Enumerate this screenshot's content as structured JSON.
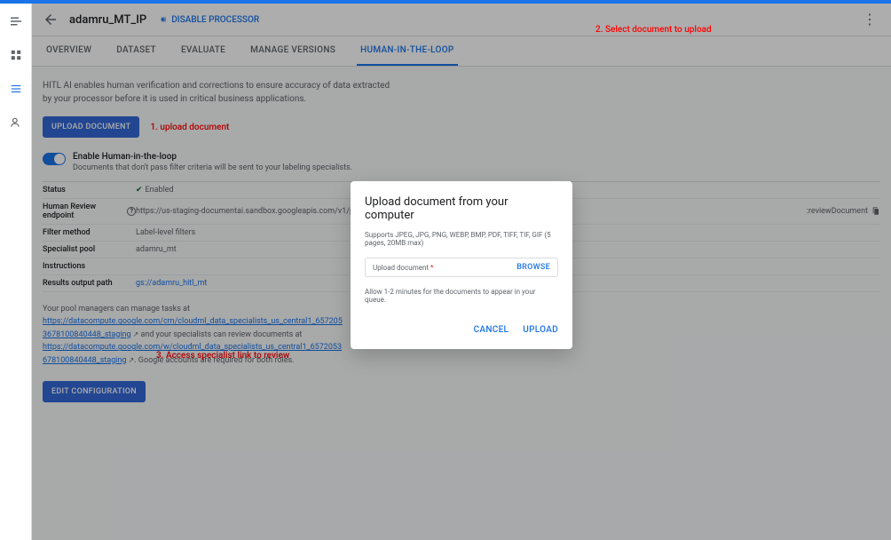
{
  "header": {
    "processor_name": "adamru_MT_IP",
    "disable_label": "DISABLE PROCESSOR"
  },
  "tabs": [
    {
      "label": "OVERVIEW"
    },
    {
      "label": "DATASET"
    },
    {
      "label": "EVALUATE"
    },
    {
      "label": "MANAGE VERSIONS"
    },
    {
      "label": "HUMAN-IN-THE-LOOP"
    }
  ],
  "hitl": {
    "description_line1": "HITL AI enables human verification and corrections to ensure accuracy of data extracted",
    "description_line2": "by your processor before it is used in critical business applications.",
    "upload_button": "UPLOAD DOCUMENT",
    "toggle_label": "Enable Human-in-the-loop",
    "toggle_sub": "Documents that don't pass filter criteria will be sent to your labeling specialists.",
    "edit_button": "EDIT CONFIGURATION"
  },
  "details": {
    "status_key": "Status",
    "status_val": "Enabled",
    "endpoint_key": "Human Review endpoint",
    "endpoint_val": "https://us-staging-documentai.sandbox.googleapis.com/v1/projects/",
    "endpoint_suffix": ":reviewDocument",
    "filter_key": "Filter method",
    "filter_val": "Label-level filters",
    "pool_key": "Specialist pool",
    "pool_val": "adamru_mt",
    "instructions_key": "Instructions",
    "instructions_val": "",
    "output_key": "Results output path",
    "output_val": "gs://adamru_hitl_mt"
  },
  "pool_info": {
    "intro": "Your pool managers can manage tasks at",
    "link1": "https://datacompute.google.com/cm/cloudml_data_specialists_us_central1_6572053678100840448_staging",
    "mid": " and your specialists can review documents at",
    "link2": "https://datacompute.google.com/w/cloudml_data_specialists_us_central1_6572053678100840448_staging",
    "tail": ". Google accounts are required for both roles."
  },
  "annotations": {
    "a1": "1. upload document",
    "a2": "2. Select document to upload",
    "a3": "3. Access specialist link to review"
  },
  "modal": {
    "title": "Upload document from your computer",
    "subtitle": "Supports JPEG, JPG, PNG, WEBP, BMP, PDF, TIFF, TIF, GIF (5 pages, 20MB max)",
    "input_label": "Upload document",
    "browse": "BROWSE",
    "note": "Allow 1-2 minutes for the documents to appear in your queue.",
    "cancel": "CANCEL",
    "upload": "UPLOAD"
  }
}
